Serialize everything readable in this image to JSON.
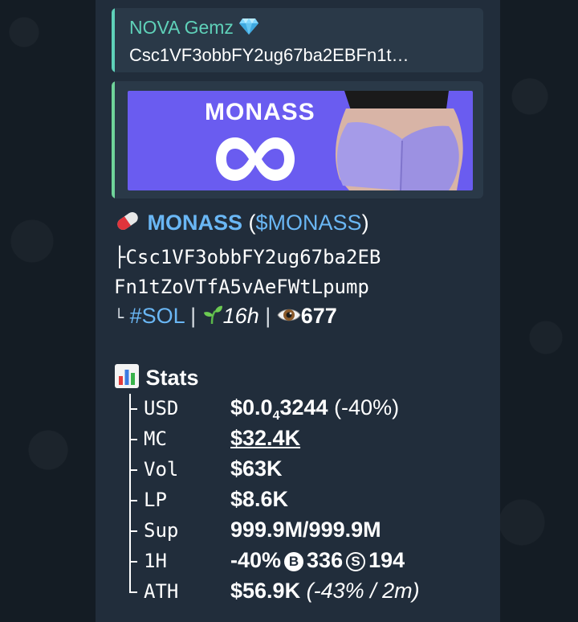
{
  "forward": {
    "channel_name": "NOVA Gemz",
    "channel_icon": "gem-icon",
    "preview_text": "Csc1VF3obbFY2ug67ba2EBFn1t…"
  },
  "media": {
    "banner_title": "MONASS",
    "logo_icon": "infinity-icon"
  },
  "token": {
    "pill_icon": "pill-icon",
    "name": "MONASS",
    "ticker_open": " (",
    "ticker": "$MONASS",
    "ticker_close": ")",
    "address_prefix": "├",
    "address_line1": "Csc1VF3obbFY2ug67ba2EB",
    "address_line2": "Fn1tZoVTfA5vAeFWtLpump",
    "meta_prefix": "└",
    "chain": "#SOL",
    "sep": "|",
    "age_icon": "seedling-icon",
    "age": "16h",
    "views_icon": "eye-icon",
    "views": "677"
  },
  "stats": {
    "header_icon": "bar-chart-icon",
    "header": "Stats",
    "usd_label": "USD",
    "usd_value_a": "$0.0",
    "usd_value_sub": "4",
    "usd_value_b": "3244",
    "usd_change": "(-40%)",
    "mc_label": "MC",
    "mc_value": "$32.4K",
    "vol_label": "Vol",
    "vol_value": "$63K",
    "lp_label": "LP",
    "lp_value": "$8.6K",
    "sup_label": "Sup",
    "sup_value": "999.9M/999.9M",
    "h1_label": "1H",
    "h1_change": "-40%",
    "buy_symbol": "B",
    "buys": "336",
    "sell_symbol": "S",
    "sells": "194",
    "ath_label": "ATH",
    "ath_value": "$56.9K",
    "ath_detail": "(-43% / 2m)"
  },
  "colors": {
    "accent_teal": "#5fd1b9",
    "link_blue": "#6ab7f5",
    "bubble_bg": "#212d3b",
    "banner_purple": "#6a5cf0"
  }
}
